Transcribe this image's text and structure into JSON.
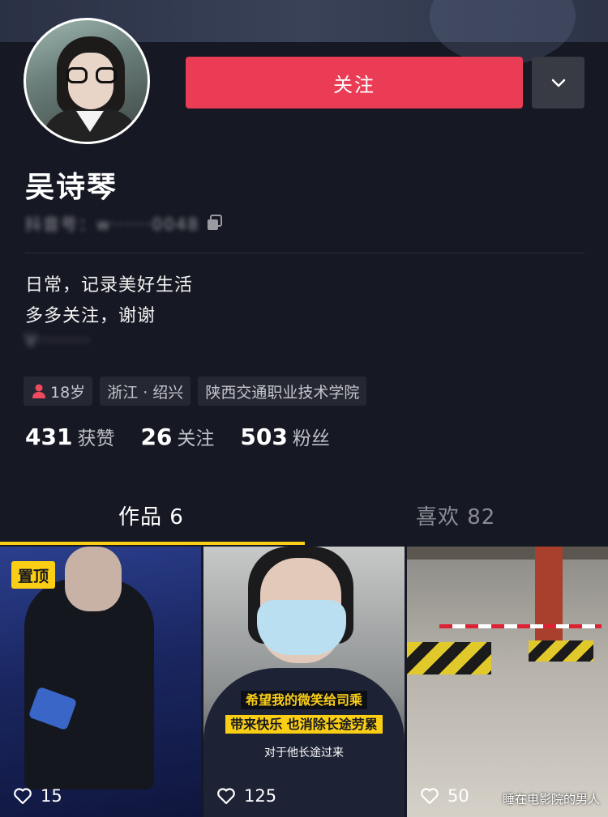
{
  "profile": {
    "name": "吴诗琴",
    "id": "抖音号：w······0048",
    "bio_line1": "日常，记录美好生活",
    "bio_line2": "多多关注，谢谢",
    "bio_line3": "V·········",
    "follow_label": "关注"
  },
  "tags": [
    {
      "label": "18岁",
      "icon": "female-icon"
    },
    {
      "label": "浙江 · 绍兴"
    },
    {
      "label": "陕西交通职业技术学院"
    }
  ],
  "stats": {
    "likes_num": "431",
    "likes_label": "获赞",
    "following_num": "26",
    "following_label": "关注",
    "followers_num": "503",
    "followers_label": "粉丝"
  },
  "tabs": {
    "works": "作品 6",
    "likes": "喜欢 82"
  },
  "videos": [
    {
      "likes": "15",
      "badge": "置顶"
    },
    {
      "likes": "125",
      "caption1": "希望我的微笑给司乘",
      "caption2": "带来快乐 也消除长途劳累",
      "caption3": "对于他长途过来"
    },
    {
      "likes": "50"
    }
  ],
  "watermark": "睡在电影院的男人",
  "colors": {
    "background": "#161823",
    "follow": "#ea3d55",
    "accent": "#face15"
  }
}
